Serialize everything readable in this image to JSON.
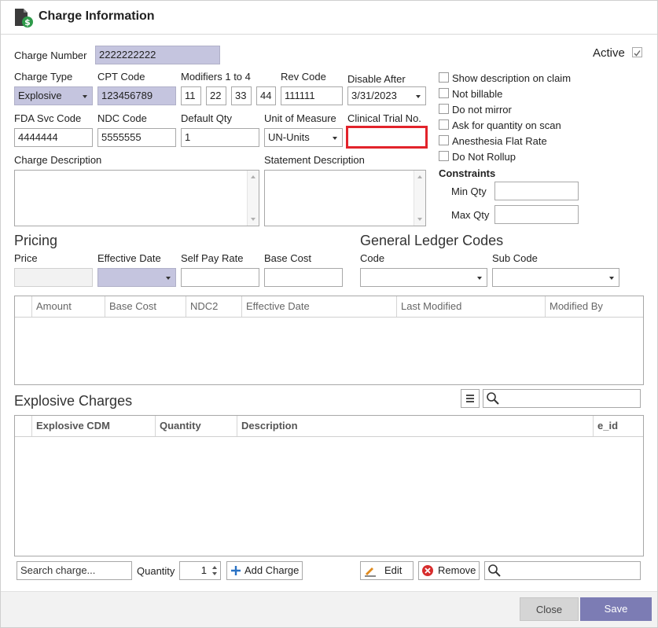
{
  "window": {
    "title": "Charge Information"
  },
  "active": {
    "label": "Active",
    "checked": true
  },
  "charge_number": {
    "label": "Charge Number",
    "value": "2222222222"
  },
  "charge_type": {
    "label": "Charge Type",
    "value": "Explosive"
  },
  "cpt_code": {
    "label": "CPT Code",
    "value": "123456789"
  },
  "modifiers": {
    "label": "Modifiers 1 to 4",
    "values": [
      "11",
      "22",
      "33",
      "44"
    ]
  },
  "rev_code": {
    "label": "Rev Code",
    "value": "111111"
  },
  "disable_after": {
    "label": "Disable After",
    "value": "3/31/2023"
  },
  "fda_svc_code": {
    "label": "FDA Svc Code",
    "value": "4444444"
  },
  "ndc_code": {
    "label": "NDC Code",
    "value": "5555555"
  },
  "default_qty": {
    "label": "Default Qty",
    "value": "1"
  },
  "unit_of_measure": {
    "label": "Unit of Measure",
    "value": "UN-Units"
  },
  "clinical_trial": {
    "label": "Clinical Trial No.",
    "value": ""
  },
  "charge_description": {
    "label": "Charge Description"
  },
  "statement_description": {
    "label": "Statement Description"
  },
  "options": [
    {
      "label": "Show description on claim",
      "checked": false
    },
    {
      "label": "Not billable",
      "checked": false
    },
    {
      "label": "Do not mirror",
      "checked": false
    },
    {
      "label": "Ask for quantity on scan",
      "checked": false
    },
    {
      "label": "Anesthesia Flat Rate",
      "checked": false
    },
    {
      "label": "Do Not Rollup",
      "checked": false
    }
  ],
  "constraints": {
    "title": "Constraints",
    "min_label": "Min Qty",
    "max_label": "Max Qty",
    "min_value": "",
    "max_value": ""
  },
  "pricing": {
    "title": "Pricing",
    "price_label": "Price",
    "effective_date_label": "Effective Date",
    "self_pay_label": "Self Pay Rate",
    "base_cost_label": "Base Cost"
  },
  "gl": {
    "title": "General Ledger Codes",
    "code_label": "Code",
    "sub_code_label": "Sub Code"
  },
  "pricing_grid": {
    "columns": [
      "Amount",
      "Base Cost",
      "NDC2",
      "Effective Date",
      "Last Modified",
      "Modified By"
    ]
  },
  "explosive": {
    "title": "Explosive Charges",
    "columns": [
      "Explosive CDM",
      "Quantity",
      "Description",
      "e_id"
    ],
    "search_charge_placeholder": "Search charge...",
    "quantity_label": "Quantity",
    "quantity_value": "1",
    "add_charge_label": "Add Charge",
    "edit_label": "Edit",
    "remove_label": "Remove"
  },
  "footer": {
    "close_label": "Close",
    "save_label": "Save"
  },
  "colors": {
    "readonly_fill": "#c5c5df",
    "error_border": "#e2232b",
    "save_button": "#7c7cb4",
    "close_button": "#d5d5d5"
  }
}
